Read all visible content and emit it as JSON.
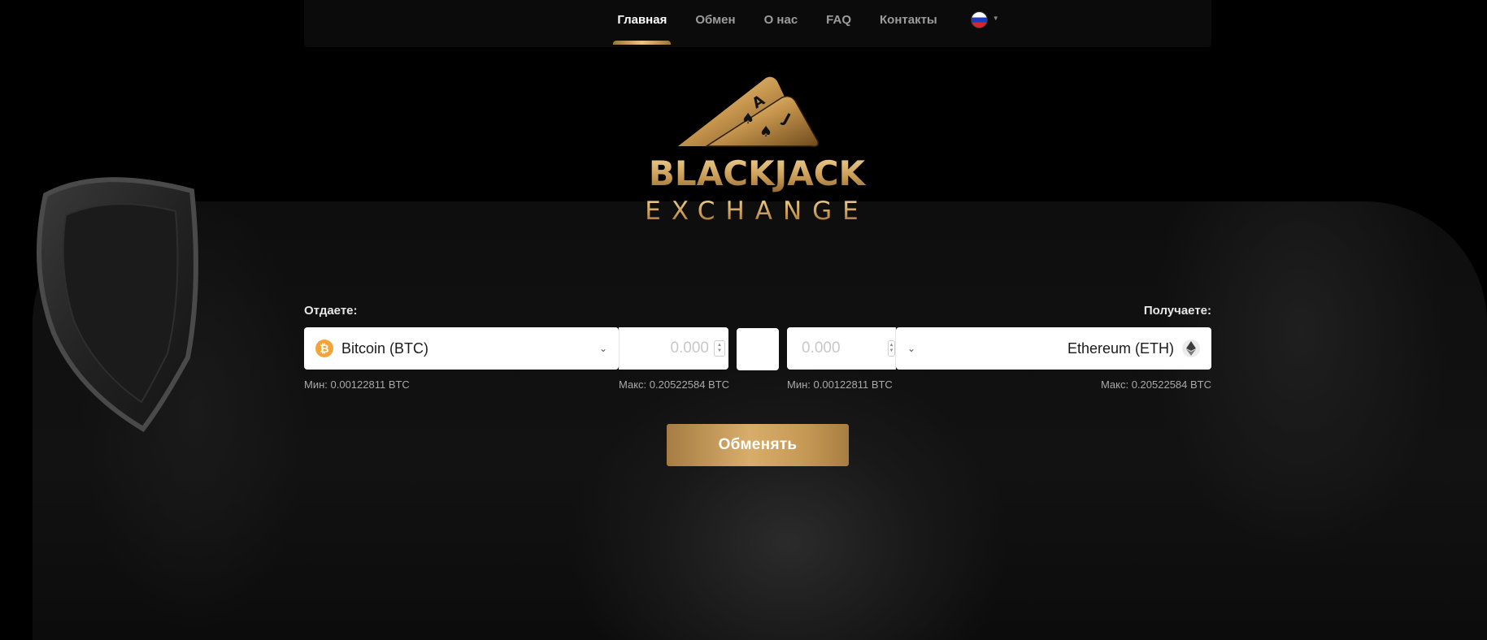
{
  "nav": {
    "items": [
      {
        "label": "Главная",
        "active": true
      },
      {
        "label": "Обмен",
        "active": false
      },
      {
        "label": "О нас",
        "active": false
      },
      {
        "label": "FAQ",
        "active": false
      },
      {
        "label": "Контакты",
        "active": false
      }
    ],
    "language_icon": "russia-flag-icon"
  },
  "logo": {
    "line1": "BLACKJACK",
    "line2": "EXCHANGE",
    "card1": "A",
    "card2": "J"
  },
  "exchange": {
    "give": {
      "label": "Отдаете:",
      "currency": "Bitcoin (BTC)",
      "icon": "bitcoin-icon",
      "placeholder": "0.000",
      "min": "Мин: 0.00122811  BTC",
      "max": "Макс: 0.20522584 BTC"
    },
    "get": {
      "label": "Получаете:",
      "currency": "Ethereum (ETH)",
      "icon": "ethereum-icon",
      "placeholder": "0.000",
      "min": "Мин: 0.00122811  BTC",
      "max": "Макс: 0.20522584 BTC"
    },
    "button": "Обменять"
  },
  "colors": {
    "accent_gold": "#c99c58",
    "bitcoin": "#f5a338",
    "background": "#000000"
  }
}
